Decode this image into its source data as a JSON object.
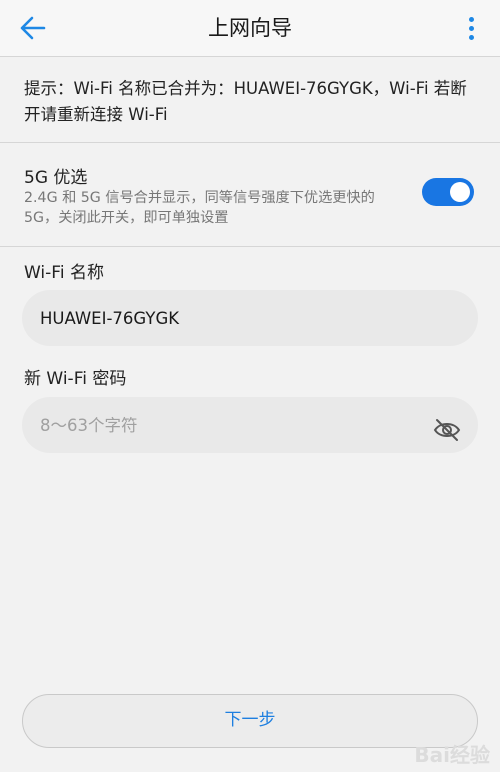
{
  "header": {
    "title": "上网向导"
  },
  "notice": {
    "text": "提示：Wi-Fi 名称已合并为：HUAWEI-76GYGK，Wi-Fi 若断开请重新连接 Wi-Fi"
  },
  "prefer_5g": {
    "title": "5G 优选",
    "description": "2.4G 和 5G 信号合并显示，同等信号强度下优选更快的 5G，关闭此开关，即可单独设置",
    "enabled": true
  },
  "wifi_name": {
    "label": "Wi-Fi 名称",
    "value": "HUAWEI-76GYGK"
  },
  "wifi_password": {
    "label": "新 Wi-Fi 密码",
    "placeholder": "8～63个字符",
    "value": ""
  },
  "next_button": {
    "label": "下一步"
  },
  "watermark": {
    "text": "Bai经验"
  },
  "colors": {
    "accent": "#1976e3",
    "background": "#f2f2f2"
  }
}
